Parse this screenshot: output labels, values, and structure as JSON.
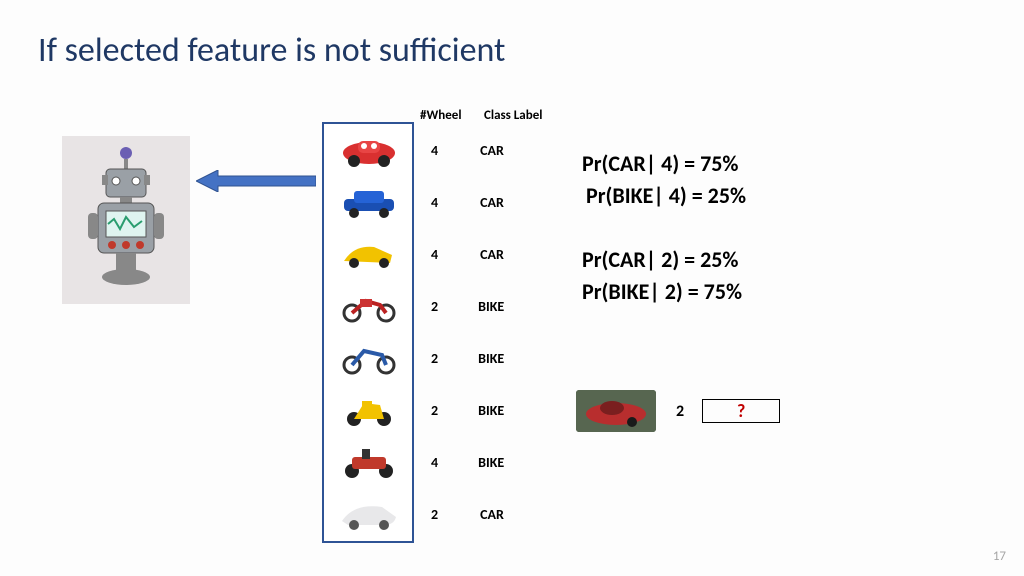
{
  "title": "If selected feature is not sufficient",
  "headers": {
    "col1": "#Wheel",
    "col2": "Class Label"
  },
  "rows": [
    {
      "wheel": "4",
      "label": "CAR"
    },
    {
      "wheel": "4",
      "label": "CAR"
    },
    {
      "wheel": "4",
      "label": "CAR"
    },
    {
      "wheel": "2",
      "label": "BIKE"
    },
    {
      "wheel": "2",
      "label": "BIKE"
    },
    {
      "wheel": "2",
      "label": "BIKE"
    },
    {
      "wheel": "4",
      "label": "BIKE"
    },
    {
      "wheel": "2",
      "label": "CAR"
    }
  ],
  "probs": {
    "line1": "Pr(CAR| 4) = 75%",
    "line2": "Pr(BIKE| 4) = 25%",
    "line3": "Pr(CAR| 2) =  25%",
    "line4": "Pr(BIKE| 2) = 75%"
  },
  "test": {
    "wheel": "2",
    "result": "?"
  },
  "page": "17"
}
